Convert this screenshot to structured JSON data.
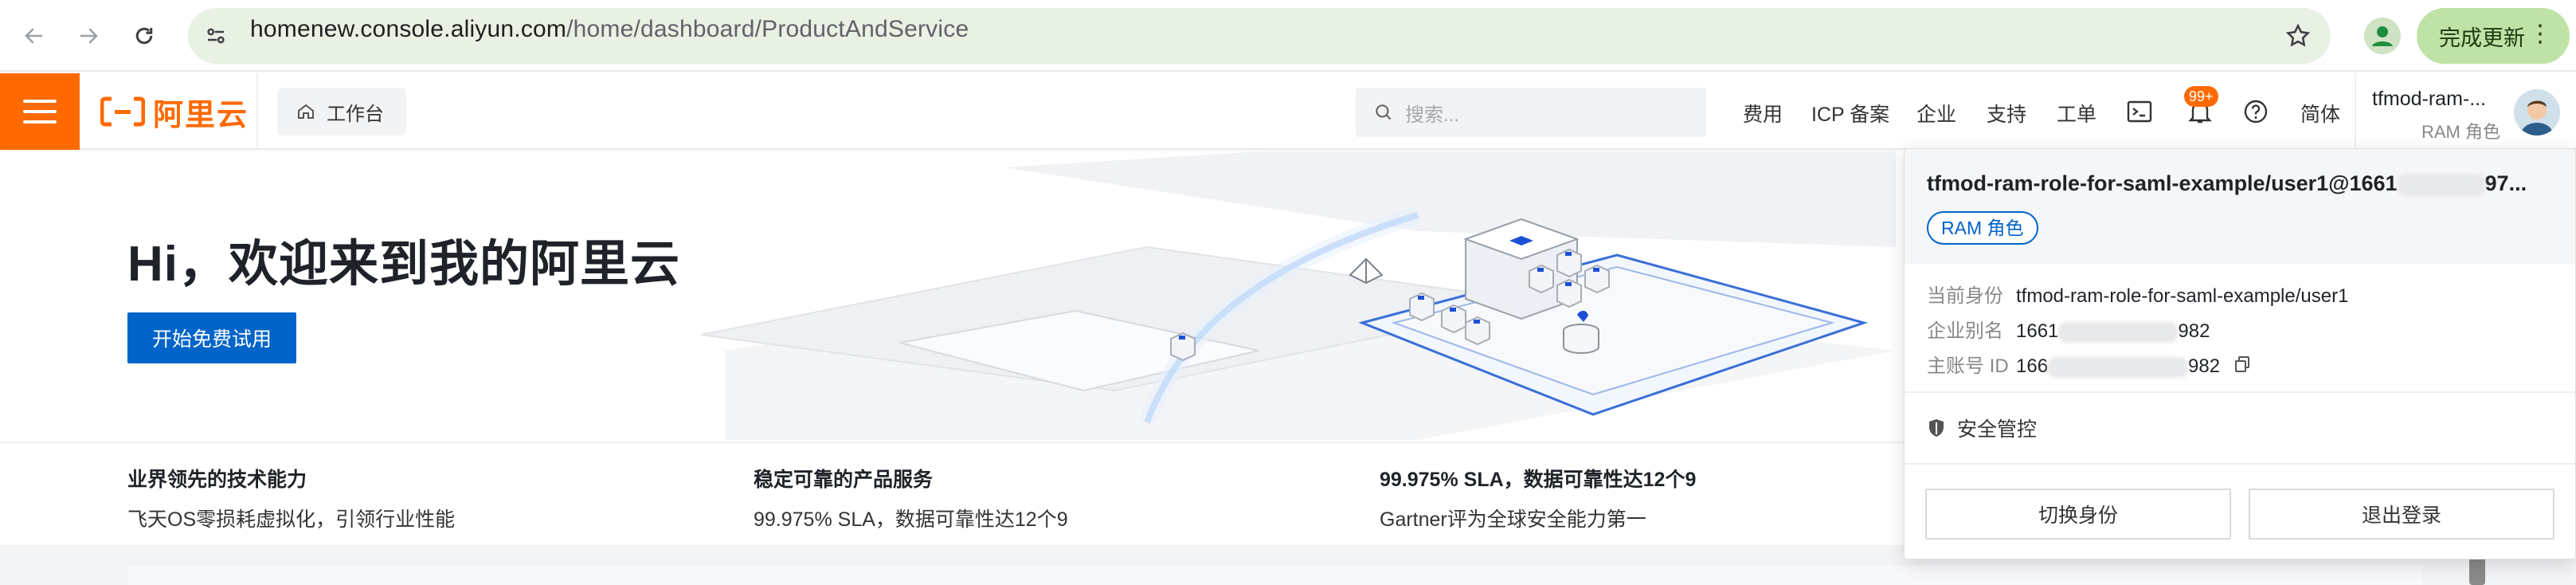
{
  "browser": {
    "url_host": "homenew.console.aliyun.com",
    "url_path": "/home/dashboard/ProductAndService",
    "update_label": "完成更新"
  },
  "topnav": {
    "logo_text": "阿里云",
    "workbench_label": "工作台",
    "search_placeholder": "搜索...",
    "items": [
      "费用",
      "ICP 备案",
      "企业",
      "支持",
      "工单"
    ],
    "notification_badge": "99+",
    "language": "简体",
    "user_name": "tfmod-ram-...",
    "user_role": "RAM 角色"
  },
  "hero": {
    "title": "Hi，欢迎来到我的阿里云",
    "trial_button": "开始免费试用"
  },
  "features": [
    {
      "title": "业界领先的技术能力",
      "desc": "飞天OS零损耗虚拟化，引领行业性能"
    },
    {
      "title": "稳定可靠的产品服务",
      "desc": "99.975% SLA，数据可靠性达12个9"
    },
    {
      "title": "99.975% SLA，数据可靠性达12个9",
      "desc": "Gartner评为全球安全能力第一"
    }
  ],
  "account_panel": {
    "account_prefix": "tfmod-ram-role-for-saml-example/user1@1661",
    "account_suffix": "97...",
    "role_tag": "RAM 角色",
    "current_identity_label": "当前身份",
    "current_identity_value": "tfmod-ram-role-for-saml-example/user1",
    "alias_label": "企业别名",
    "alias_prefix": "1661",
    "alias_suffix": "982",
    "main_id_label": "主账号 ID",
    "main_id_prefix": "166",
    "main_id_suffix": "982",
    "security_label": "安全管控",
    "switch_button": "切换身份",
    "logout_button": "退出登录"
  }
}
